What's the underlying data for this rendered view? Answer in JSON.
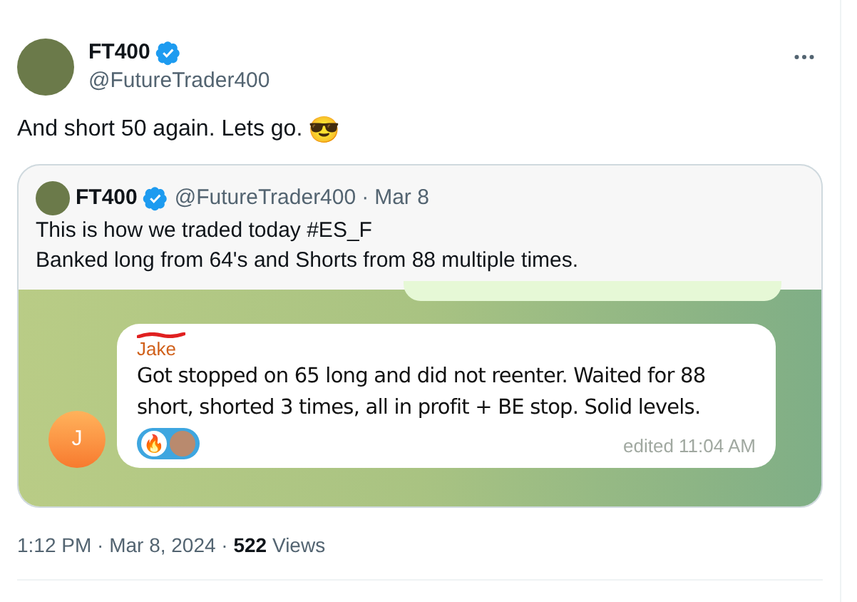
{
  "tweet": {
    "name": "FT400",
    "verified": true,
    "handle": "@FutureTrader400",
    "text": "And short 50 again. Lets go.",
    "emoji": "😎"
  },
  "quote": {
    "name": "FT400",
    "verified": true,
    "handle": "@FutureTrader400",
    "separator": "·",
    "date": "Mar 8",
    "lines": [
      "This is how we traded today #ES_F",
      "Banked long from 64's and Shorts from 88 multiple times."
    ],
    "chat": {
      "sender": "Jake",
      "sender_redacted": true,
      "avatar_letter": "J",
      "text": "Got stopped on 65 long and did not reenter. Waited for 88 short, shorted 3 times, all in profit + BE stop.  Solid levels.",
      "reaction_emoji": "🔥",
      "time": "edited 11:04 AM"
    }
  },
  "meta": "1:12 PM · Mar 8, 2024 · **522** Views"
}
